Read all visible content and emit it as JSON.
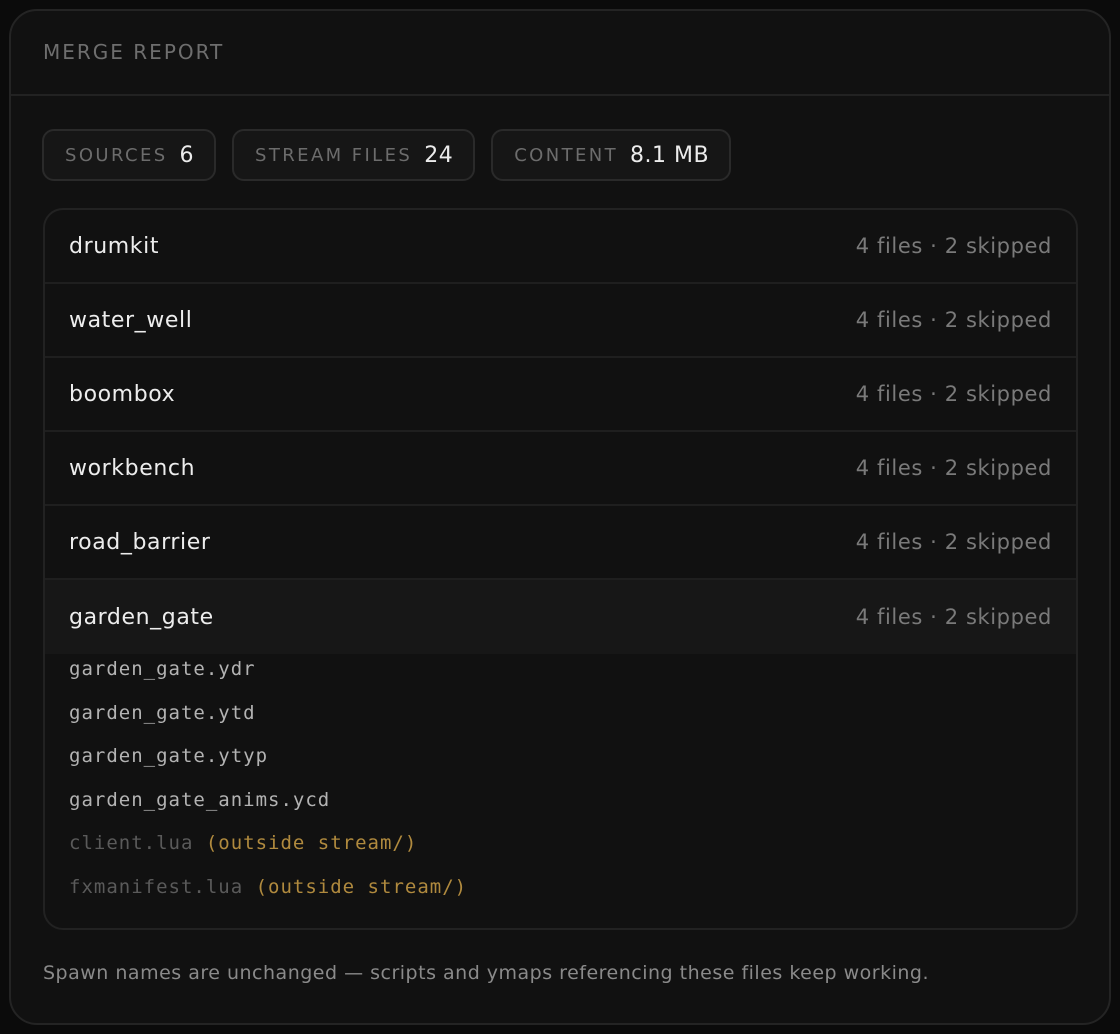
{
  "header": {
    "title": "MERGE REPORT"
  },
  "stats": [
    {
      "label": "SOURCES",
      "value": "6"
    },
    {
      "label": "STREAM FILES",
      "value": "24"
    },
    {
      "label": "CONTENT",
      "value": "8.1 MB"
    }
  ],
  "sources": [
    {
      "name": "drumkit",
      "meta": "4 files · 2 skipped"
    },
    {
      "name": "water_well",
      "meta": "4 files · 2 skipped"
    },
    {
      "name": "boombox",
      "meta": "4 files · 2 skipped"
    },
    {
      "name": "workbench",
      "meta": "4 files · 2 skipped"
    },
    {
      "name": "road_barrier",
      "meta": "4 files · 2 skipped"
    },
    {
      "name": "garden_gate",
      "meta": "4 files · 2 skipped"
    }
  ],
  "expanded_files": [
    {
      "name": "garden_gate.ydr",
      "note": ""
    },
    {
      "name": "garden_gate.ytd",
      "note": ""
    },
    {
      "name": "garden_gate.ytyp",
      "note": ""
    },
    {
      "name": "garden_gate_anims.ycd",
      "note": ""
    },
    {
      "name": "client.lua",
      "note": "(outside stream/)"
    },
    {
      "name": "fxmanifest.lua",
      "note": "(outside stream/)"
    }
  ],
  "footer": {
    "text": "Spawn names are unchanged — scripts and ymaps referencing these files keep working."
  },
  "colors": {
    "note_accent": "#b08a3e",
    "panel_bg": "#111111"
  }
}
